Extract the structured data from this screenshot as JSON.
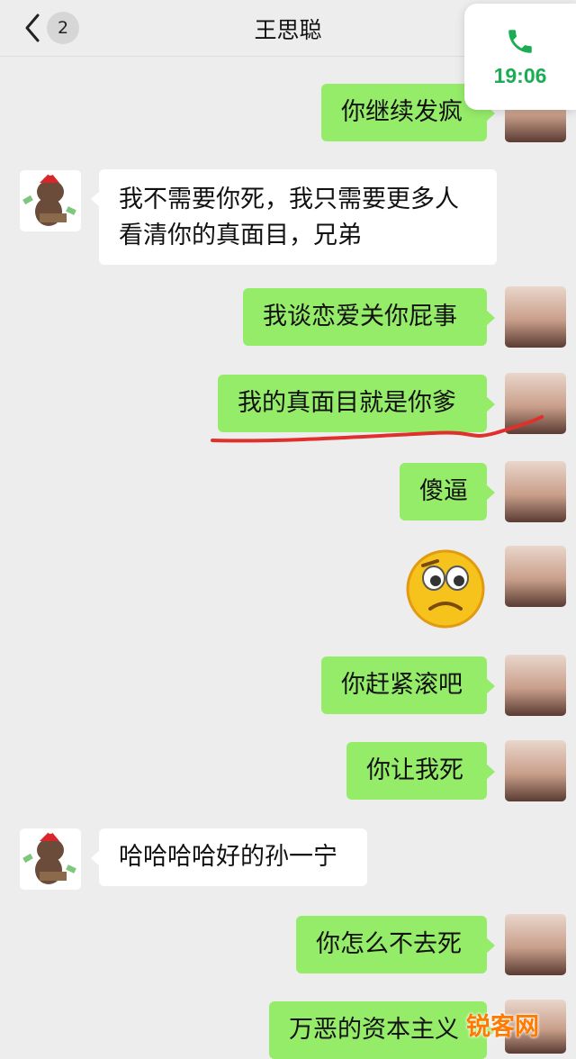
{
  "header": {
    "unread_count": "2",
    "contact_name": "王思聪"
  },
  "call_widget": {
    "time": "19:06"
  },
  "messages": [
    {
      "side": "right",
      "text": "你继续发疯"
    },
    {
      "side": "left",
      "text": "我不需要你死，我只需要更多人",
      "text2": "看清你的真面目，兄弟"
    },
    {
      "side": "right",
      "text": "我谈恋爱关你屁事"
    },
    {
      "side": "right",
      "text": "我的真面目就是你爹"
    },
    {
      "side": "right",
      "text": "傻逼"
    },
    {
      "side": "right",
      "sticker": "worried-face-emoji"
    },
    {
      "side": "right",
      "text": "你赶紧滚吧"
    },
    {
      "side": "right",
      "text": "你让我死"
    },
    {
      "side": "left",
      "text": "哈哈哈哈好的孙一宁"
    },
    {
      "side": "right",
      "text": "你怎么不去死"
    },
    {
      "side": "right",
      "text": "万恶的资本主义"
    }
  ],
  "watermark": "锐客网",
  "colors": {
    "background": "#ededed",
    "green_bubble": "#95ec69",
    "white_bubble": "#ffffff",
    "call_green": "#1aad53",
    "underline_red": "#e0302b"
  }
}
